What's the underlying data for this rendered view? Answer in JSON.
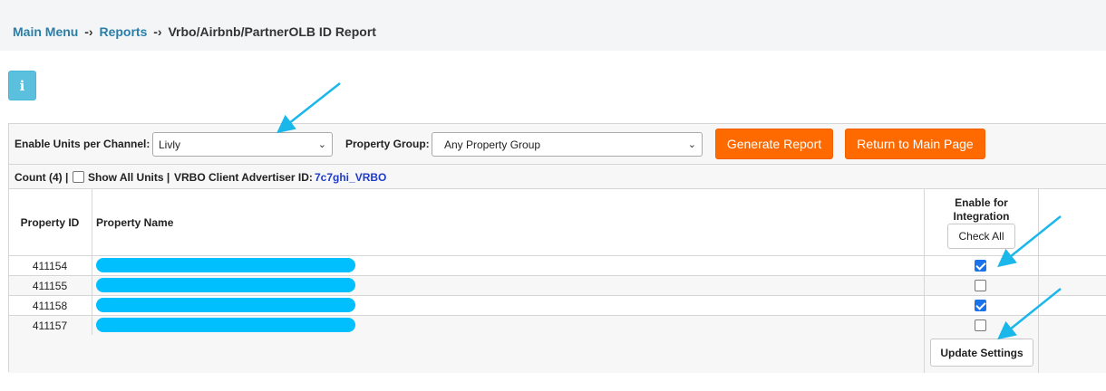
{
  "breadcrumb": {
    "main_menu": "Main Menu",
    "reports": "Reports",
    "separator": "-›",
    "current": "Vrbo/Airbnb/PartnerOLB ID Report"
  },
  "info_button": {
    "icon": "info-icon",
    "glyph": "i"
  },
  "filters": {
    "channel_label": "Enable Units per Channel:",
    "channel_value": "Livly",
    "group_label": "Property Group:",
    "group_value": "Any Property Group",
    "generate_label": "Generate Report",
    "return_label": "Return to Main Page"
  },
  "count_bar": {
    "count_text": "Count (4) |",
    "show_all_label": "Show All Units |",
    "advertiser_label": "VRBO Client Advertiser ID:",
    "advertiser_id": "7c7ghi_VRBO"
  },
  "table": {
    "col_id": "Property ID",
    "col_name": "Property Name",
    "col_enable_1": "Enable for",
    "col_enable_2": "Integration",
    "check_all_label": "Check All",
    "rows": [
      {
        "id": "411154",
        "enabled": true
      },
      {
        "id": "411155",
        "enabled": false
      },
      {
        "id": "411158",
        "enabled": true
      },
      {
        "id": "411157",
        "enabled": false
      }
    ],
    "update_label": "Update Settings"
  },
  "colors": {
    "accent_orange": "#ff6a00",
    "link_blue": "#2a7fa8",
    "redaction_cyan": "#00bfff",
    "info_blue": "#5bc0de"
  }
}
